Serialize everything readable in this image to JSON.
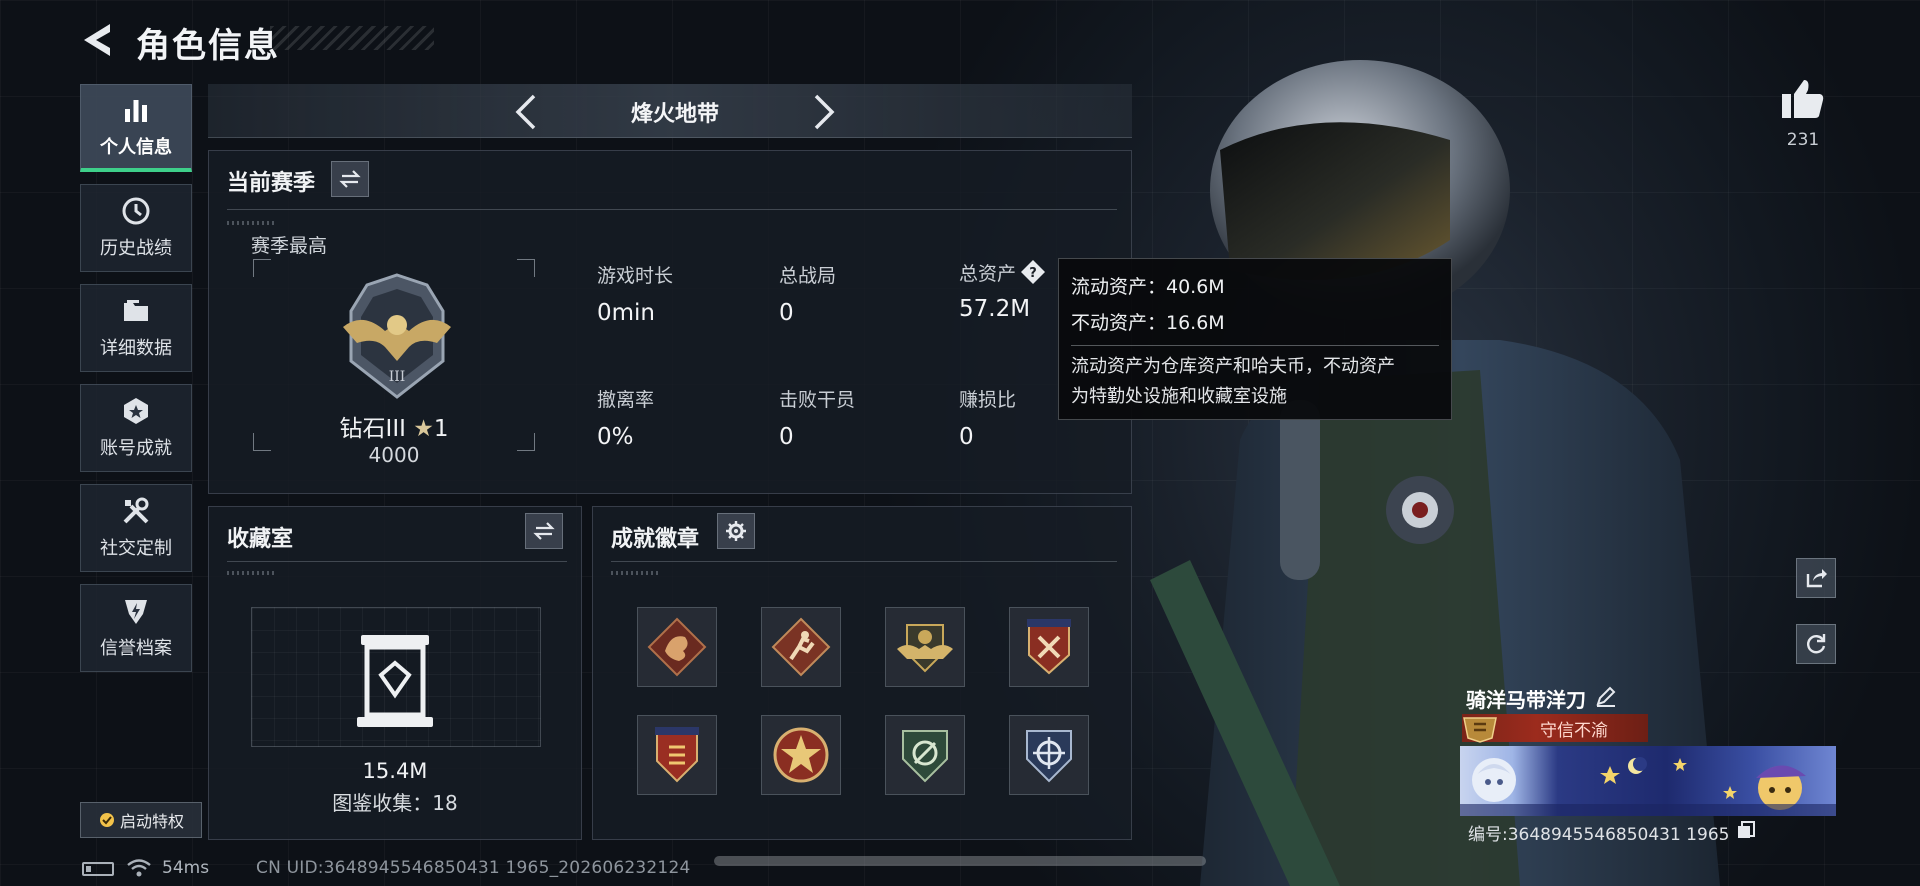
{
  "header": {
    "title": "角色信息"
  },
  "nav": {
    "items": [
      {
        "label": "个人信息",
        "icon": "bar-chart-icon",
        "active": true
      },
      {
        "label": "历史战绩",
        "icon": "clock-icon",
        "active": false
      },
      {
        "label": "详细数据",
        "icon": "folder-icon",
        "active": false
      },
      {
        "label": "账号成就",
        "icon": "medal-icon",
        "active": false
      },
      {
        "label": "社交定制",
        "icon": "tools-icon",
        "active": false
      },
      {
        "label": "信誉档案",
        "icon": "shield-lightning-icon",
        "active": false
      }
    ],
    "privilege_label": "启动特权"
  },
  "mode": {
    "name": "烽火地带"
  },
  "season": {
    "title": "当前赛季",
    "best_label": "赛季最高",
    "rank_name": "钻石III",
    "rank_stars": "1",
    "rank_score": "4000",
    "stats": [
      {
        "label": "游戏时长",
        "value": "0min"
      },
      {
        "label": "总战局",
        "value": "0"
      },
      {
        "label": "总资产",
        "value": "57.2M"
      },
      {
        "label": "撤离率",
        "value": "0%"
      },
      {
        "label": "击败干员",
        "value": "0"
      },
      {
        "label": "赚损比",
        "value": "0"
      }
    ]
  },
  "tooltip": {
    "liquid": "流动资产：40.6M",
    "fixed": "不动资产：16.6M",
    "desc_1": "流动资产为仓库资产和哈夫币，不动资产",
    "desc_2": "为特勤处设施和收藏室设施"
  },
  "collection": {
    "title": "收藏室",
    "value": "15.4M",
    "count_text": "图鉴收集：18"
  },
  "badges": {
    "title": "成就徽章",
    "items": [
      "dragon-badge-icon",
      "runner-badge-icon",
      "eagle-wings-badge-icon",
      "stars-badge-icon",
      "shield-stripe-badge-icon",
      "star-wheel-badge-icon",
      "green-shield-badge-icon",
      "crosshair-badge-icon"
    ]
  },
  "profile": {
    "likes": "231",
    "player_name": "骑洋马带洋刀",
    "honor_title": "守信不渝",
    "player_id": "编号:3648945546850431 1965"
  },
  "status": {
    "ping": "54ms",
    "uid": "CN UID:3648945546850431 1965_202606232124"
  },
  "colors": {
    "accent_green": "#3ed08a",
    "honor_red": "#9c2b1d",
    "panel_bg": "#161c24"
  }
}
